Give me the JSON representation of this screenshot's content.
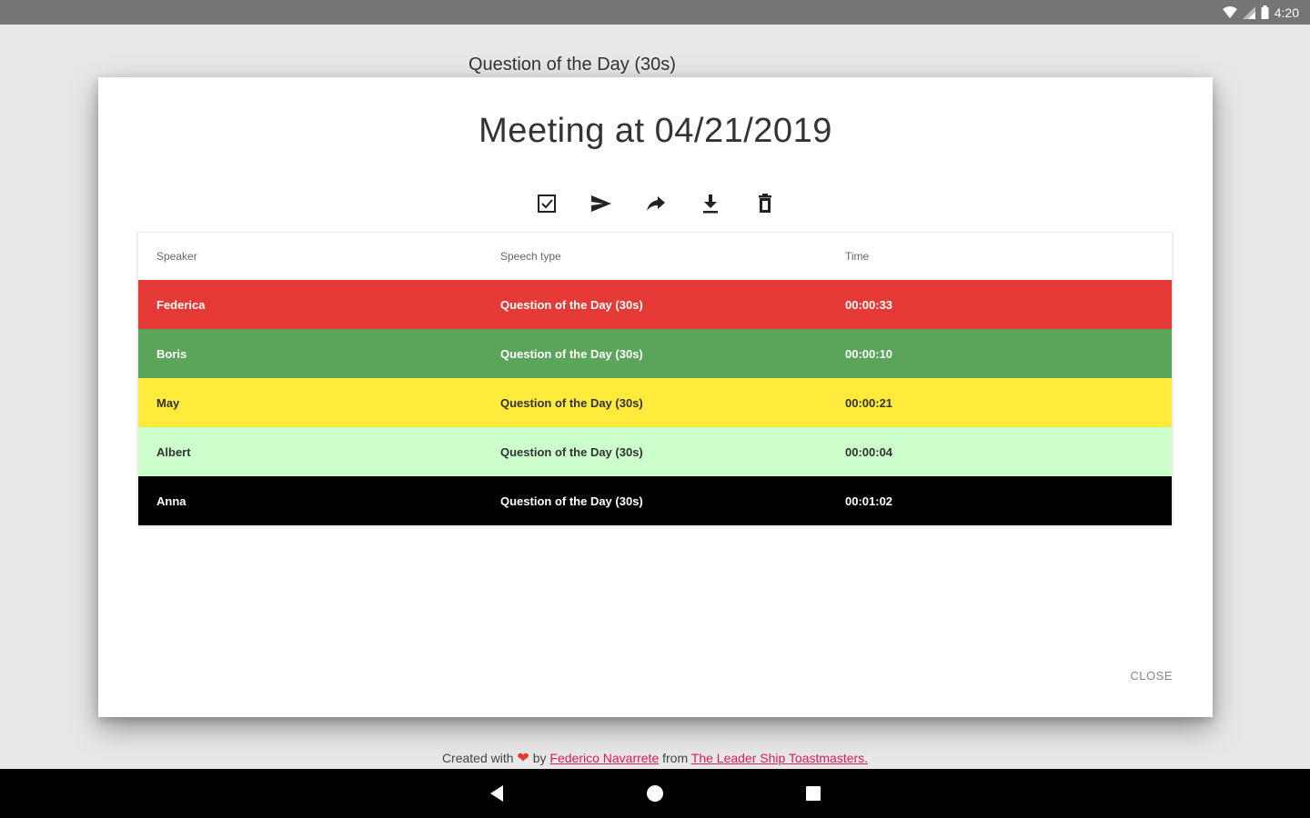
{
  "status": {
    "time": "4:20"
  },
  "background": {
    "title": "Question of the Day (30s)"
  },
  "dialog": {
    "title": "Meeting at 04/21/2019",
    "close_label": "CLOSE",
    "toolbar": [
      {
        "name": "select-all-icon"
      },
      {
        "name": "send-icon"
      },
      {
        "name": "share-icon"
      },
      {
        "name": "download-icon"
      },
      {
        "name": "delete-icon"
      }
    ],
    "table": {
      "headers": [
        "Speaker",
        "Speech type",
        "Time"
      ],
      "rows": [
        {
          "speaker": "Federica",
          "type": "Question of the Day (30s)",
          "time": "00:00:33",
          "bg": "#e53935",
          "fg": "#ffffff"
        },
        {
          "speaker": "Boris",
          "type": "Question of the Day (30s)",
          "time": "00:00:10",
          "bg": "#5aa55a",
          "fg": "#ffffff"
        },
        {
          "speaker": "May",
          "type": "Question of the Day (30s)",
          "time": "00:00:21",
          "bg": "#ffeb3b",
          "fg": "#333333"
        },
        {
          "speaker": "Albert",
          "type": "Question of the Day (30s)",
          "time": "00:00:04",
          "bg": "#ccffcc",
          "fg": "#333333"
        },
        {
          "speaker": "Anna",
          "type": "Question of the Day (30s)",
          "time": "00:01:02",
          "bg": "#000000",
          "fg": "#ffffff"
        }
      ]
    }
  },
  "footer": {
    "prefix": "Created with",
    "by": "by",
    "author": "Federico Navarrete",
    "from": "from",
    "club": "The Leader Ship Toastmasters."
  }
}
